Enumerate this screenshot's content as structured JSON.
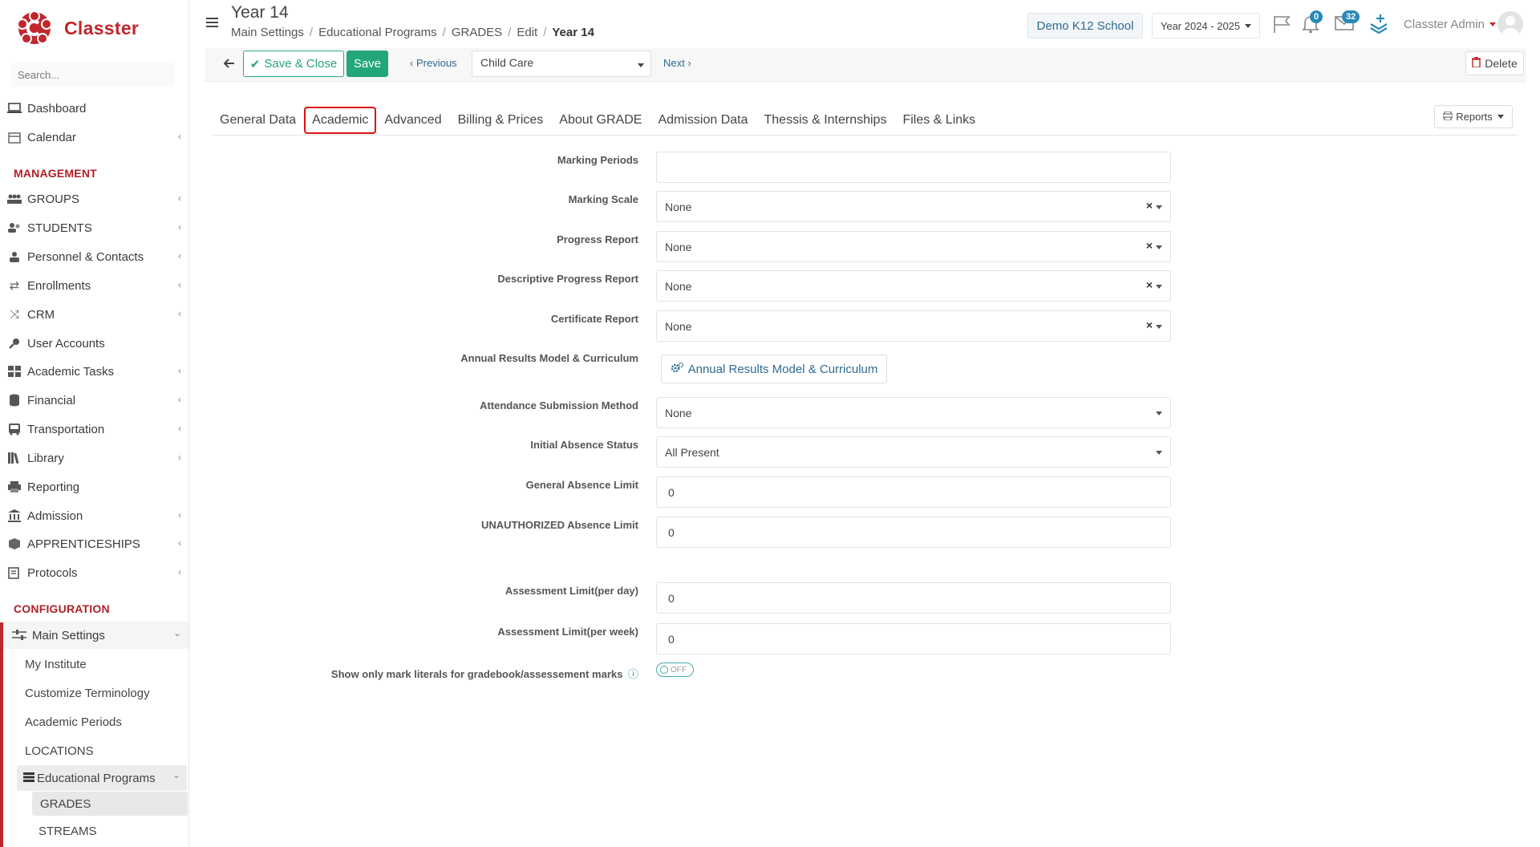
{
  "app": {
    "name": "Classter"
  },
  "sidebar": {
    "search_placeholder": "Search...",
    "items": [
      {
        "label": "Dashboard"
      },
      {
        "label": "Calendar"
      }
    ],
    "management_title": "MANAGEMENT",
    "management": [
      {
        "label": "GROUPS"
      },
      {
        "label": "STUDENTS"
      },
      {
        "label": "Personnel & Contacts"
      },
      {
        "label": "Enrollments"
      },
      {
        "label": "CRM"
      },
      {
        "label": "User Accounts"
      },
      {
        "label": "Academic Tasks"
      },
      {
        "label": "Financial"
      },
      {
        "label": "Transportation"
      },
      {
        "label": "Library"
      },
      {
        "label": "Reporting"
      },
      {
        "label": "Admission"
      },
      {
        "label": "APPRENTICESHIPS"
      },
      {
        "label": "Protocols"
      }
    ],
    "configuration_title": "CONFIGURATION",
    "main_settings": "Main Settings",
    "settings_items": [
      {
        "label": "My Institute"
      },
      {
        "label": "Customize Terminology"
      },
      {
        "label": "Academic Periods"
      },
      {
        "label": "LOCATIONS"
      }
    ],
    "educational_programs": "Educational Programs",
    "program_items": [
      {
        "label": "GRADES"
      },
      {
        "label": "STREAMS"
      }
    ]
  },
  "header": {
    "title": "Year 14",
    "breadcrumb": [
      "Main Settings",
      "Educational Programs",
      "GRADES",
      "Edit",
      "Year 14"
    ],
    "school": "Demo K12 School",
    "year": "Year 2024 - 2025",
    "notifications_count": "0",
    "messages_count": "32",
    "user": "Classter Admin"
  },
  "toolbar": {
    "save_close": "Save & Close",
    "save": "Save",
    "previous": "Previous",
    "grade_select": "Child Care",
    "next": "Next",
    "delete": "Delete"
  },
  "tabs": [
    "General Data",
    "Academic",
    "Advanced",
    "Billing & Prices",
    "About GRADE",
    "Admission Data",
    "Thessis & Internships",
    "Files & Links"
  ],
  "active_tab": "Academic",
  "reports": "Reports",
  "form": {
    "marking_periods": {
      "label": "Marking Periods",
      "value": ""
    },
    "marking_scale": {
      "label": "Marking Scale",
      "value": "None"
    },
    "progress_report": {
      "label": "Progress Report",
      "value": "None"
    },
    "descriptive_progress_report": {
      "label": "Descriptive Progress Report",
      "value": "None"
    },
    "certificate_report": {
      "label": "Certificate Report",
      "value": "None"
    },
    "annual_results": {
      "label": "Annual Results Model & Curriculum",
      "button": "Annual Results Model & Curriculum"
    },
    "attendance_method": {
      "label": "Attendance Submission Method",
      "value": "None"
    },
    "initial_absence": {
      "label": "Initial Absence Status",
      "value": "All Present"
    },
    "general_absence_limit": {
      "label": "General Absence Limit",
      "value": "0"
    },
    "unauthorized_absence_limit": {
      "label": "UNAUTHORIZED Absence Limit",
      "value": "0"
    },
    "assessment_day": {
      "label": "Assessment Limit(per day)",
      "value": "0"
    },
    "assessment_week": {
      "label": "Assessment Limit(per week)",
      "value": "0"
    },
    "mark_literals": {
      "label": "Show only mark literals for gradebook/assessement marks",
      "toggle": "OFF"
    }
  },
  "colors": {
    "brand": "#c0272d",
    "accent": "#23a67a",
    "link": "#2f6a8f"
  }
}
